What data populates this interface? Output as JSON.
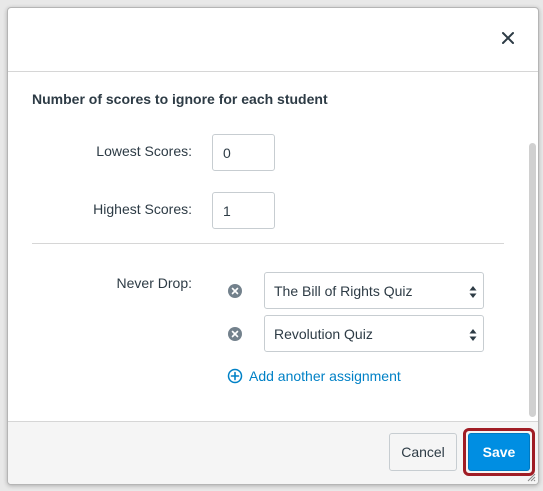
{
  "dialog": {
    "close_icon": "close-icon"
  },
  "body": {
    "section_title": "Number of scores to ignore for each student",
    "lowest": {
      "label": "Lowest Scores:",
      "value": "0"
    },
    "highest": {
      "label": "Highest Scores:",
      "value": "1"
    },
    "never_drop": {
      "label": "Never Drop:",
      "assignments": [
        {
          "selected": "The Bill of Rights Quiz"
        },
        {
          "selected": "Revolution Quiz"
        }
      ],
      "add_label": "Add another assignment"
    }
  },
  "footer": {
    "cancel_label": "Cancel",
    "save_label": "Save"
  },
  "colors": {
    "accent": "#008ee2",
    "link": "#0081c6",
    "highlight_outline": "#a01d25"
  }
}
